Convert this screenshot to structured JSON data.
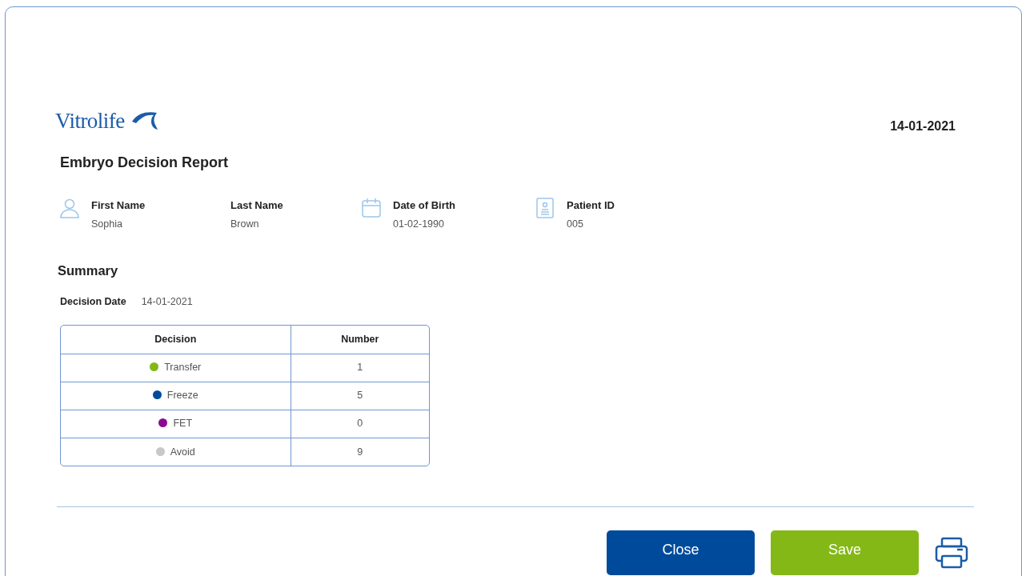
{
  "logo": {
    "text": "Vitrolife"
  },
  "report_date": "14-01-2021",
  "title": "Embryo Decision Report",
  "patient_fields": [
    {
      "kind": "person",
      "label": "First Name",
      "value": "Sophia"
    },
    {
      "kind": "plain",
      "label": "Last Name",
      "value": "Brown"
    },
    {
      "kind": "date",
      "label": "Date of Birth",
      "value": "01-02-1990"
    },
    {
      "kind": "id",
      "label": "Patient ID",
      "value": "005"
    }
  ],
  "summary": {
    "title": "Summary",
    "decision_date_label": "Decision Date",
    "decision_date": "14-01-2021",
    "table": {
      "columns": [
        "Decision",
        "Number"
      ],
      "rows": [
        {
          "decision": "Transfer",
          "color": "#84b817",
          "number": "1"
        },
        {
          "decision": "Freeze",
          "color": "#004a9c",
          "number": "5"
        },
        {
          "decision": "FET",
          "color": "#8b0a93",
          "number": "0"
        },
        {
          "decision": "Avoid",
          "color": "#c8c8c8",
          "number": "9"
        }
      ]
    }
  },
  "buttons": [
    {
      "kind": "close",
      "label": "Close"
    },
    {
      "kind": "save",
      "label": "Save"
    }
  ]
}
